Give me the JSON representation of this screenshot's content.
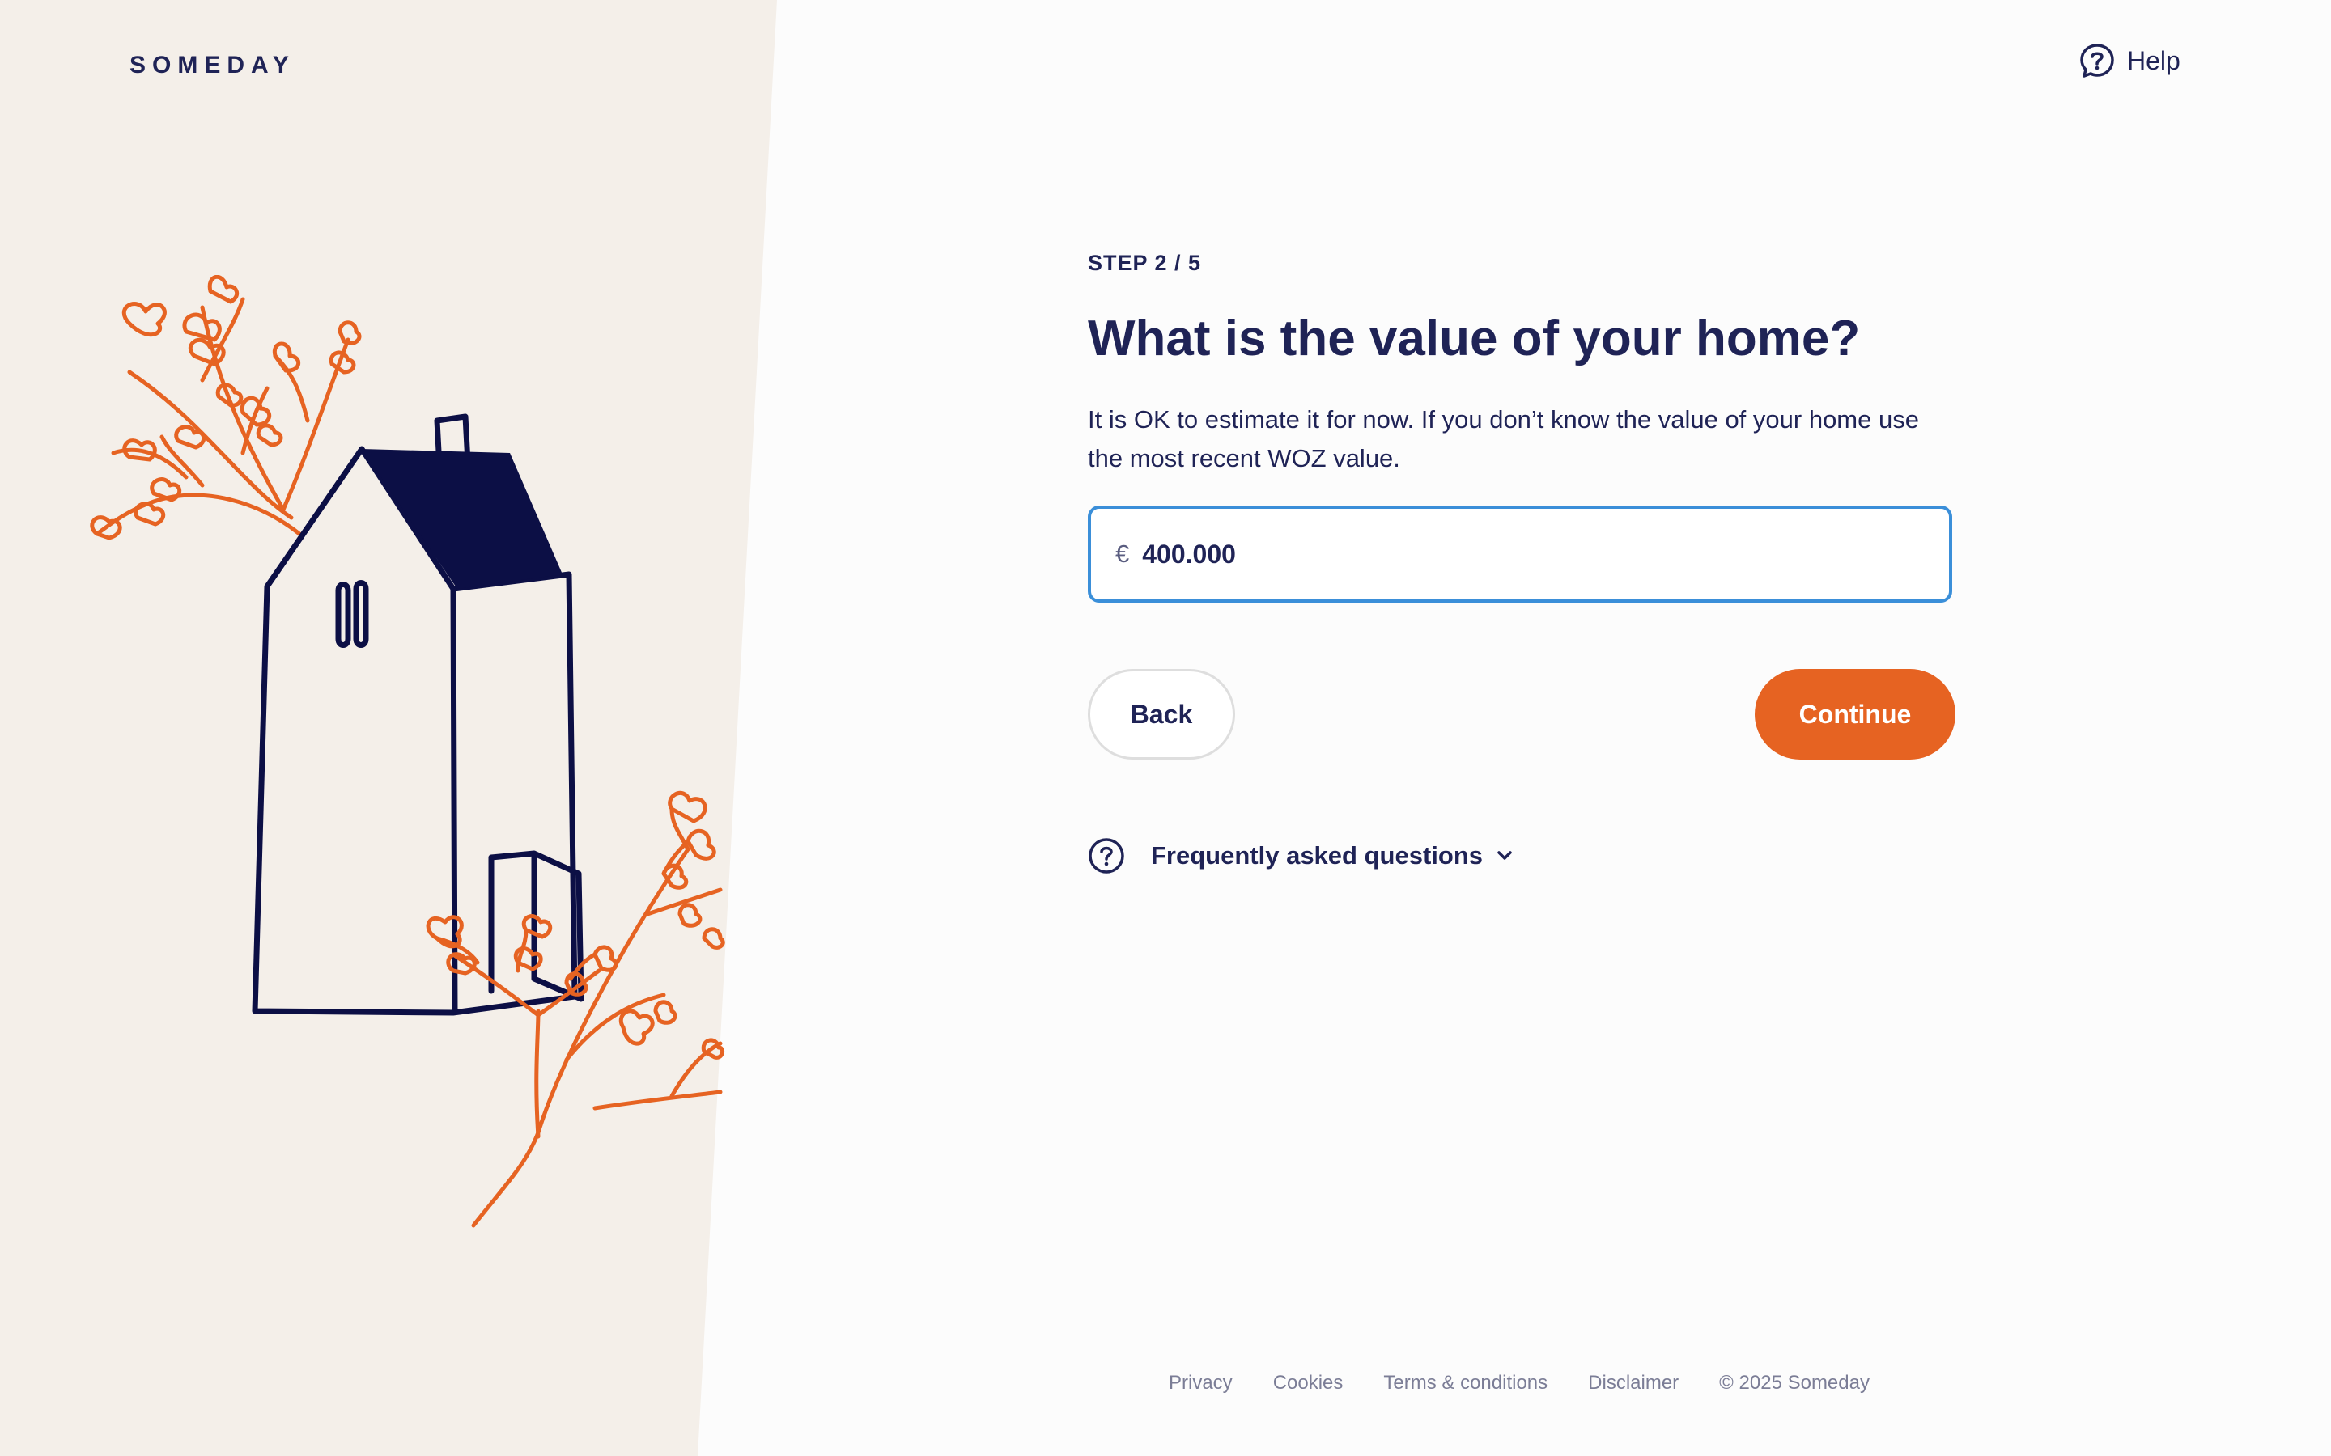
{
  "brand": {
    "logo_text": "SOMEDAY"
  },
  "header": {
    "help_label": "Help"
  },
  "form": {
    "step_label": "STEP 2 / 5",
    "title": "What is the value of your home?",
    "description": "It is OK to estimate it for now. If you don’t know the value of your home use the most recent WOZ value.",
    "currency_symbol": "€",
    "value": "400.000"
  },
  "actions": {
    "back_label": "Back",
    "continue_label": "Continue"
  },
  "faq": {
    "label": "Frequently asked questions"
  },
  "footer": {
    "links": [
      "Privacy",
      "Cookies",
      "Terms & conditions",
      "Disclaimer"
    ],
    "copyright": "© 2025 Someday"
  },
  "colors": {
    "accent": "#e66322",
    "navy": "#1f2356",
    "panel": "#f4efe9",
    "focus": "#3b8fd9"
  }
}
